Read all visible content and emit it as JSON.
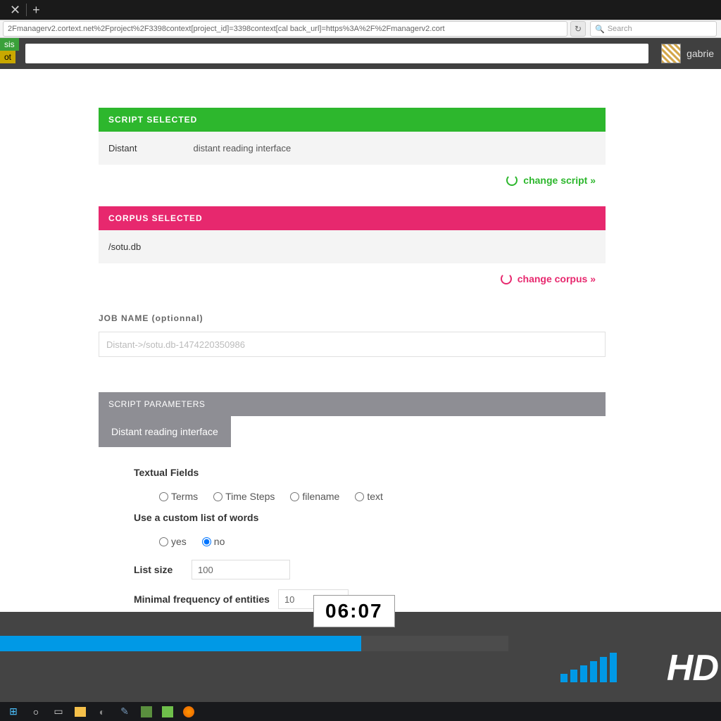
{
  "browser": {
    "url": "2Fmanagerv2.cortext.net%2Fproject%2F3398context[project_id]=3398context[cal back_url]=https%3A%2F%2Fmanagerv2.cort",
    "search_placeholder": "Search"
  },
  "header": {
    "sis": "sis",
    "ot": "ot",
    "username": "gabrie"
  },
  "script_section": {
    "title": "SCRIPT SELECTED",
    "name": "Distant",
    "desc": "distant reading interface",
    "action": "change script »"
  },
  "corpus_section": {
    "title": "CORPUS SELECTED",
    "name": "/sotu.db",
    "action": "change corpus »"
  },
  "job": {
    "label": "JOB NAME (optionnal)",
    "value": "Distant->/sotu.db-1474220350986"
  },
  "params": {
    "title": "SCRIPT PARAMETERS",
    "tab": "Distant reading interface",
    "textual_fields_label": "Textual Fields",
    "fields": {
      "terms": "Terms",
      "timesteps": "Time Steps",
      "filename": "filename",
      "text": "text"
    },
    "custom_list_label": "Use a custom list of words",
    "yes": "yes",
    "no": "no",
    "list_size_label": "List size",
    "list_size_value": "100",
    "min_freq_label": "Minimal frequency of entities",
    "min_freq_value": "10"
  },
  "video": {
    "time": "06:07",
    "hd": "HD"
  }
}
